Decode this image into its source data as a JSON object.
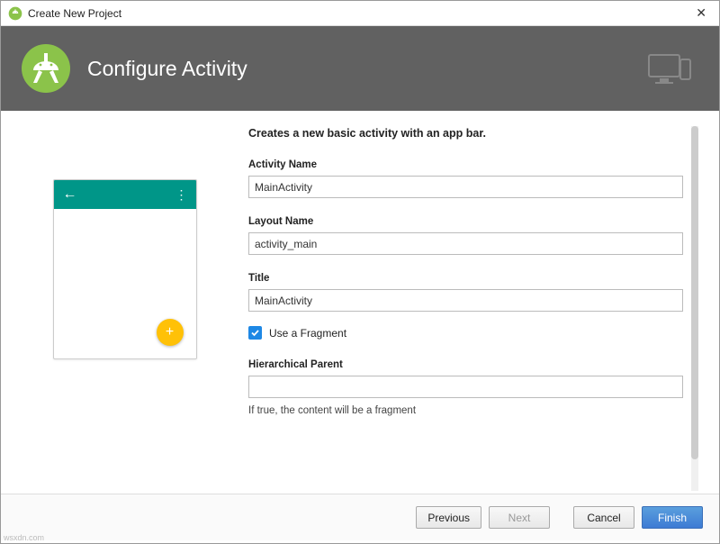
{
  "window": {
    "title": "Create New Project",
    "close_glyph": "✕"
  },
  "header": {
    "title": "Configure Activity"
  },
  "form": {
    "description": "Creates a new basic activity with an app bar.",
    "activity_name_label": "Activity Name",
    "activity_name_value": "MainActivity",
    "layout_name_label": "Layout Name",
    "layout_name_value": "activity_main",
    "title_label": "Title",
    "title_value": "MainActivity",
    "use_fragment_label": "Use a Fragment",
    "use_fragment_checked": true,
    "hierarchical_parent_label": "Hierarchical Parent",
    "hierarchical_parent_value": "",
    "helper_text": "If true, the content will be a fragment"
  },
  "preview": {
    "back_glyph": "←",
    "menu_glyph": "⋮",
    "fab_glyph": "+"
  },
  "footer": {
    "previous": "Previous",
    "next": "Next",
    "cancel": "Cancel",
    "finish": "Finish"
  },
  "colors": {
    "header_bg": "#616161",
    "appbar": "#009688",
    "fab": "#FFC107",
    "checkbox": "#1E88E5",
    "primary_btn": "#4a8ad6"
  },
  "watermark": "wsxdn.com"
}
